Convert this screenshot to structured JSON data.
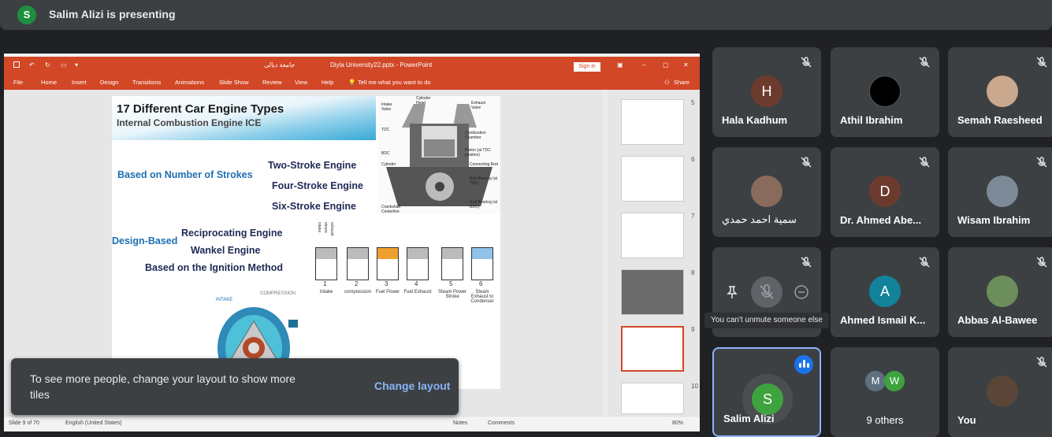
{
  "presenting": {
    "avatar_letter": "S",
    "text": "Salim Alizi is presenting"
  },
  "powerpoint": {
    "title_arabic": "جامعة ديالى",
    "filename": "Diyla University22.pptx - PowerPoint",
    "sign_in": "Sign in",
    "menu": [
      "File",
      "Home",
      "Insert",
      "Design",
      "Transitions",
      "Animations",
      "Slide Show",
      "Review",
      "View",
      "Help"
    ],
    "tell_me": "Tell me what you want to do",
    "share": "Share",
    "slide": {
      "title": "17 Different Car Engine Types",
      "subtitle": "Internal Combustion Engine ICE",
      "based_strokes": "Based on Number of Strokes",
      "two_stroke": "Two-Stroke Engine",
      "four_stroke": "Four-Stroke Engine",
      "six_stroke": "Six-Stroke Engine",
      "design_based": "Design-Based",
      "reciprocating": "Reciprocating Engine",
      "wankel": "Wankel Engine",
      "ignition": "Based on the Ignition Method",
      "engine_labels": [
        "Intake Valve",
        "Cylinder Head",
        "Exhaust Valve",
        "TDC",
        "Combustion Chamber",
        "BDC",
        "Piston (at TDC position)",
        "Cylinder",
        "Connecting Rod",
        "Rod Bearing (at TDC)",
        "Crankshaft Centerline",
        "Rod Bearing (at BDC)"
      ],
      "stroke_numbers": [
        "1",
        "2",
        "3",
        "4",
        "5",
        "6"
      ],
      "stroke_labels": [
        "Intake",
        "compression",
        "Fuel Power",
        "Fuel Exhaust",
        "Steam Power Stroke",
        "Steam Exhaust to Condenser"
      ],
      "valve_labels": [
        "intake",
        "steam",
        "exhaust"
      ],
      "wankel_intake": "INTAKE",
      "wankel_compression": "COMPRESSION"
    },
    "thumbnails": [
      "5",
      "6",
      "7",
      "8",
      "9",
      "10"
    ],
    "status": {
      "slide": "Slide 9 of 70",
      "language": "English (United States)",
      "notes": "Notes",
      "comments": "Comments",
      "zoom": "80%"
    }
  },
  "toast": {
    "message": "To see more people, change your layout to show more tiles",
    "action": "Change layout"
  },
  "participants": [
    {
      "name": "Hala Kadhum",
      "avatar": "H",
      "color": "#6d3b2e"
    },
    {
      "name": "Athil Ibrahim"
    },
    {
      "name": "Semah Raesheed"
    },
    {
      "name": "سمية احمد حمدي"
    },
    {
      "name": "Dr. Ahmed Abe...",
      "avatar": "D",
      "color": "#6d3b2e"
    },
    {
      "name": "Wisam Ibrahim"
    },
    {
      "name": "Ahmed Ismail K...",
      "avatar": "A",
      "color": "#12839a"
    },
    {
      "name": "Abbas Al-Bawee"
    },
    {
      "name": "Salim Alizi",
      "avatar": "S",
      "color": "#3ea33e"
    },
    {
      "name": "9 others",
      "mini": [
        "M",
        "W"
      ]
    },
    {
      "name": "You"
    }
  ],
  "tooltip": "You can't unmute someone else"
}
